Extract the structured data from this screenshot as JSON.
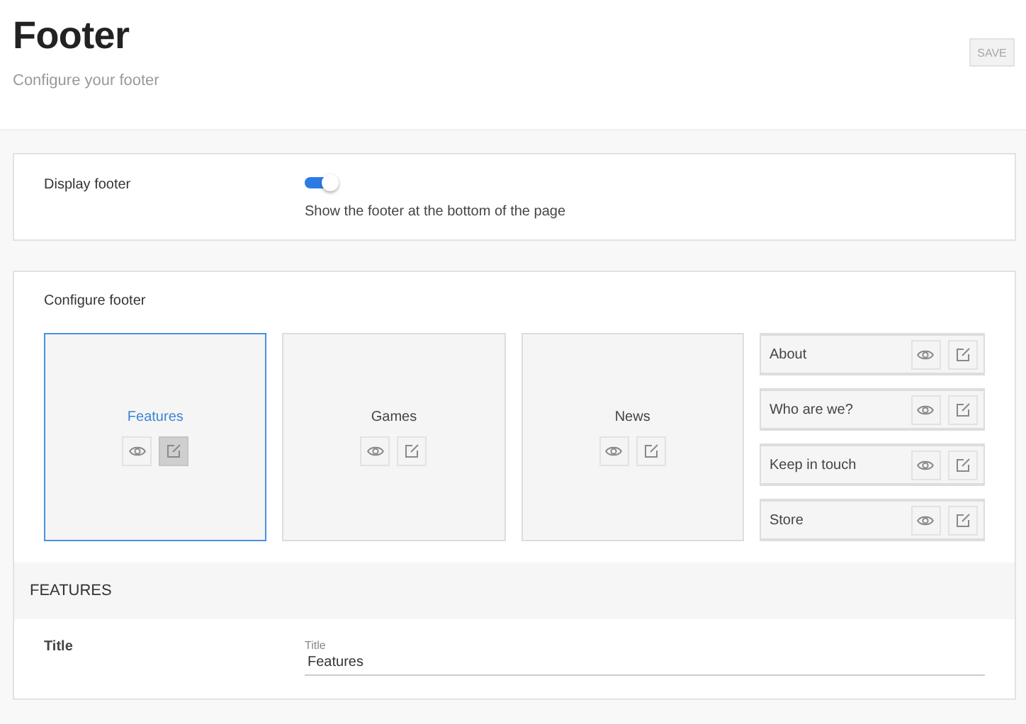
{
  "header": {
    "title": "Footer",
    "subtitle": "Configure your footer",
    "save_button": {
      "label": "SAVE",
      "disabled": true
    }
  },
  "display": {
    "label": "Display footer",
    "on": true,
    "hint": "Show the footer at the bottom of the page"
  },
  "configure": {
    "label": "Configure footer",
    "blocks": [
      {
        "label": "Features",
        "selected": true,
        "editing": true
      },
      {
        "label": "Games",
        "selected": false,
        "editing": false
      },
      {
        "label": "News",
        "selected": false,
        "editing": false
      }
    ],
    "links": [
      {
        "label": "About",
        "selected": false
      },
      {
        "label": "Who are we?",
        "selected": false
      },
      {
        "label": "Keep in touch",
        "selected": false
      },
      {
        "label": "Store",
        "selected": false
      }
    ]
  },
  "editor": {
    "heading": "FEATURES",
    "field_label": "Title",
    "input": {
      "label": "Title",
      "value": "Features"
    }
  }
}
